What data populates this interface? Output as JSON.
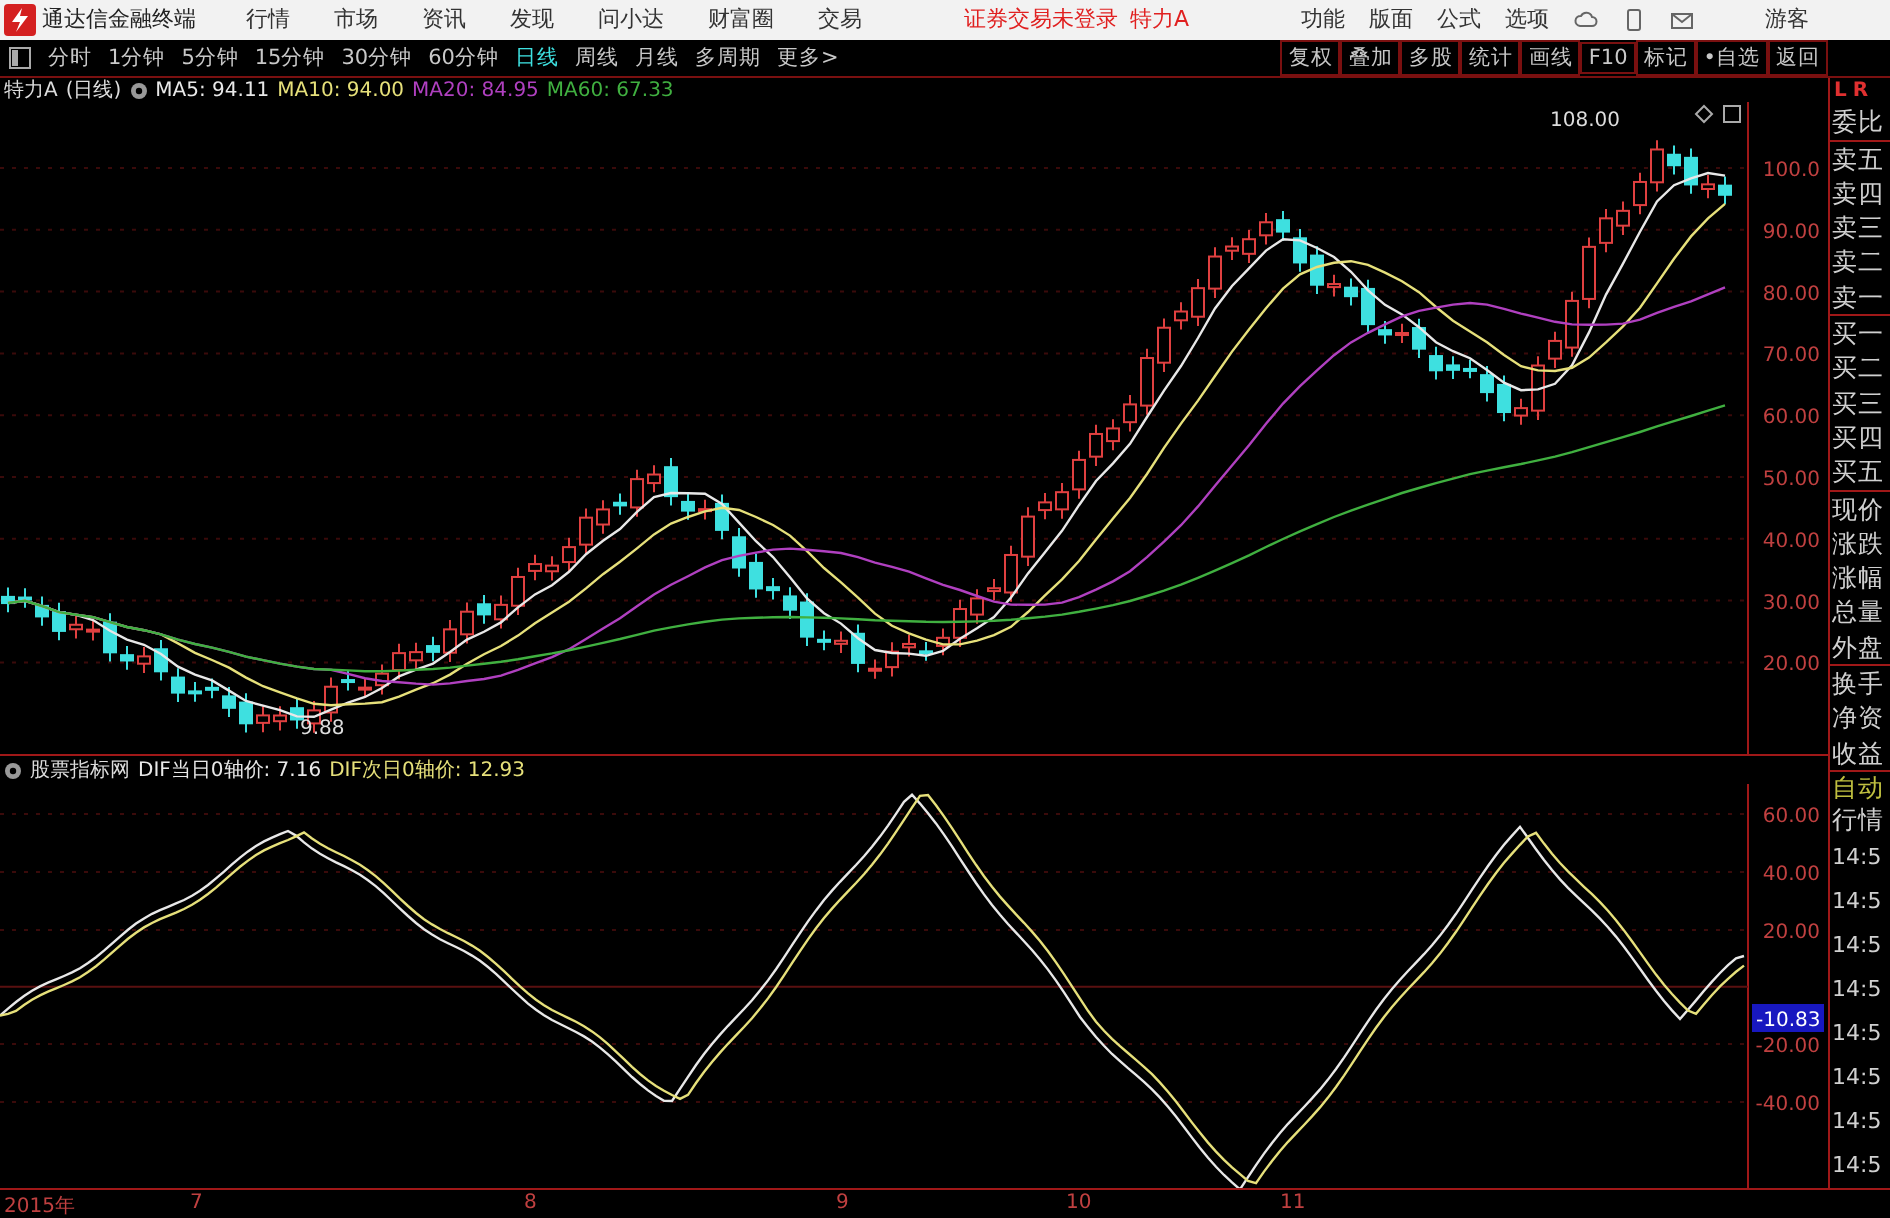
{
  "app": {
    "title": "通达信金融终端"
  },
  "menu": [
    "行情",
    "市场",
    "资讯",
    "发现",
    "问小达",
    "财富圈",
    "交易"
  ],
  "login_status": "证券交易未登录",
  "stock_name": "特力A",
  "top_actions": [
    "功能",
    "版面",
    "公式",
    "选项"
  ],
  "user": "游客",
  "periods": [
    {
      "label": "分时",
      "selected": false
    },
    {
      "label": "1分钟",
      "selected": false
    },
    {
      "label": "5分钟",
      "selected": false
    },
    {
      "label": "15分钟",
      "selected": false
    },
    {
      "label": "30分钟",
      "selected": false
    },
    {
      "label": "60分钟",
      "selected": false
    },
    {
      "label": "日线",
      "selected": true
    },
    {
      "label": "周线",
      "selected": false
    },
    {
      "label": "月线",
      "selected": false
    },
    {
      "label": "多周期",
      "selected": false
    },
    {
      "label": "更多>",
      "selected": false
    }
  ],
  "tools": [
    "复权",
    "叠加",
    "多股",
    "统计",
    "画线",
    "F10",
    "标记",
    "•自选",
    "返回"
  ],
  "price_chart": {
    "stock": "特力A",
    "period": "(日线)",
    "ma": [
      {
        "label": "MA5: 94.11",
        "color": "#e8e8e8"
      },
      {
        "label": "MA10: 94.00",
        "color": "#e6e07a"
      },
      {
        "label": "MA20: 84.95",
        "color": "#b040c0"
      },
      {
        "label": "MA60: 67.33",
        "color": "#40b040"
      }
    ],
    "yticks": [
      "100.0",
      "90.00",
      "80.00",
      "70.00",
      "60.00",
      "50.00",
      "40.00",
      "30.00",
      "20.00"
    ],
    "high_label": "108.00",
    "low_label": "9.88"
  },
  "indicator_chart": {
    "name": "股票指标网",
    "values": [
      {
        "label": "DIF当日0轴价: 7.16",
        "color": "#e8e8e8"
      },
      {
        "label": "DIF次日0轴价: 12.93",
        "color": "#e6e07a"
      }
    ],
    "yticks": [
      "60.00",
      "40.00",
      "20.00",
      "-20.00",
      "-40.00"
    ],
    "current_value": "-10.83"
  },
  "x_axis": [
    "2015年",
    "7",
    "8",
    "9",
    "10",
    "11"
  ],
  "side_panel": {
    "header": [
      "L",
      "R"
    ],
    "quote_labels": [
      "委比",
      "卖五",
      "卖四",
      "卖三",
      "卖二",
      "卖一",
      "买一",
      "买二",
      "买三",
      "买四",
      "买五",
      "现价",
      "涨跌",
      "涨幅",
      "总量",
      "外盘",
      "换手",
      "净资",
      "收益"
    ],
    "tabs": [
      "自动",
      "行情"
    ],
    "times": [
      "14:5",
      "14:5",
      "14:5",
      "14:5",
      "14:5",
      "14:5",
      "14:5",
      "14:5"
    ]
  }
}
